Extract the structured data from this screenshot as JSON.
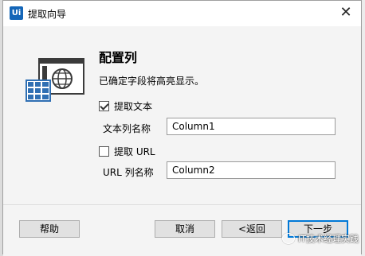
{
  "window": {
    "title": "提取向导",
    "app_icon_text": "Ui"
  },
  "page": {
    "heading": "配置列",
    "description": "已确定字段将高亮显示。"
  },
  "fields": {
    "extract_text": {
      "checkbox_label": "提取文本",
      "checked": true,
      "name_label": "文本列名称",
      "value": "Column1"
    },
    "extract_url": {
      "checkbox_label": "提取 URL",
      "checked": false,
      "name_label": "URL 列名称",
      "value": "Column2"
    }
  },
  "buttons": {
    "help": "帮助",
    "cancel": "取消",
    "back": "<返回",
    "next": "下一步"
  },
  "watermark": "IT技术经理实践",
  "colors": {
    "accent": "#0078d7",
    "illustration": "#2f6fb3",
    "illustration_dark": "#3b3b3b"
  }
}
